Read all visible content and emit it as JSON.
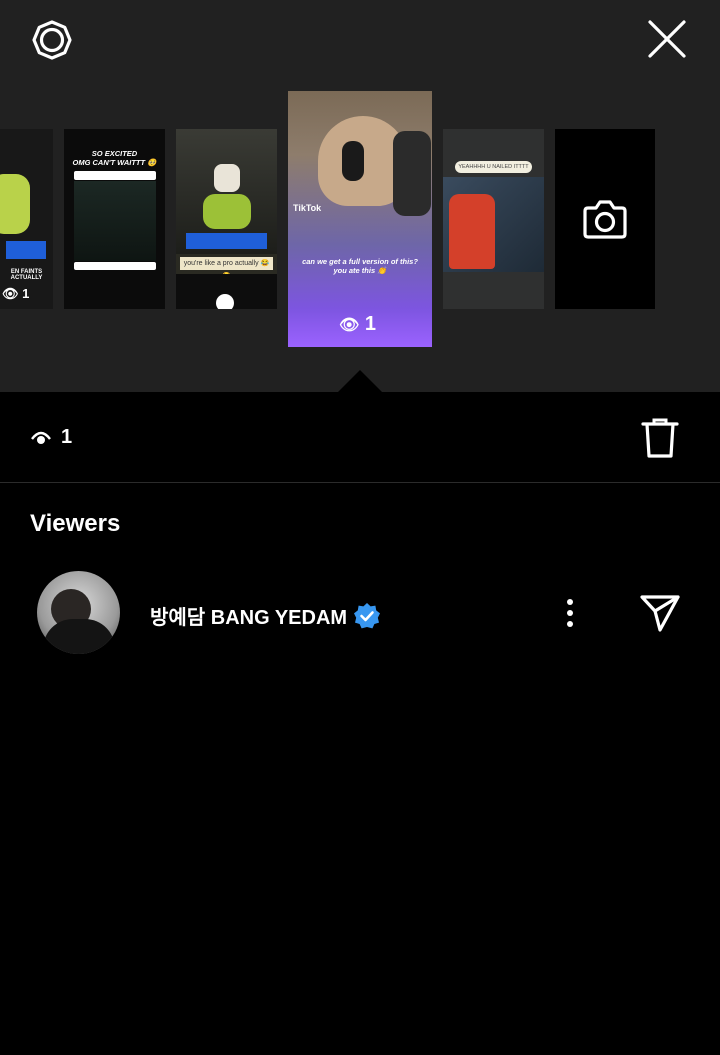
{
  "toolbar": {
    "settings_icon": "gear-outline-icon",
    "close_icon": "close-icon"
  },
  "tray": {
    "items": [
      {
        "views": "1",
        "caption": "EN FAINTS ACTUALLY"
      },
      {
        "caption_line1": "SO EXCITED",
        "caption_line2": "OMG CAN'T WAITTT 🥺"
      },
      {
        "caption": "you're like a pro actually 😂😂"
      },
      {
        "caption": "can we get a full version of this? you ate this 👏",
        "tiktok_label": "TikTok",
        "views": "1"
      },
      {
        "caption": "YEAHHHH U NAILED ITTTT"
      },
      {
        "icon": "camera-icon"
      }
    ],
    "selected_index": 3
  },
  "stats": {
    "views": "1",
    "eye_icon": "eye-icon",
    "delete_icon": "trash-icon"
  },
  "viewers": {
    "title": "Viewers",
    "list": [
      {
        "name": "방예담 BANG YEDAM",
        "verified": true,
        "more_icon": "more-vertical-icon",
        "send_icon": "send-icon"
      }
    ]
  },
  "colors": {
    "background": "#000000",
    "tray_bg": "#212121",
    "verified": "#3897F0",
    "divider": "#2b2b2b"
  }
}
